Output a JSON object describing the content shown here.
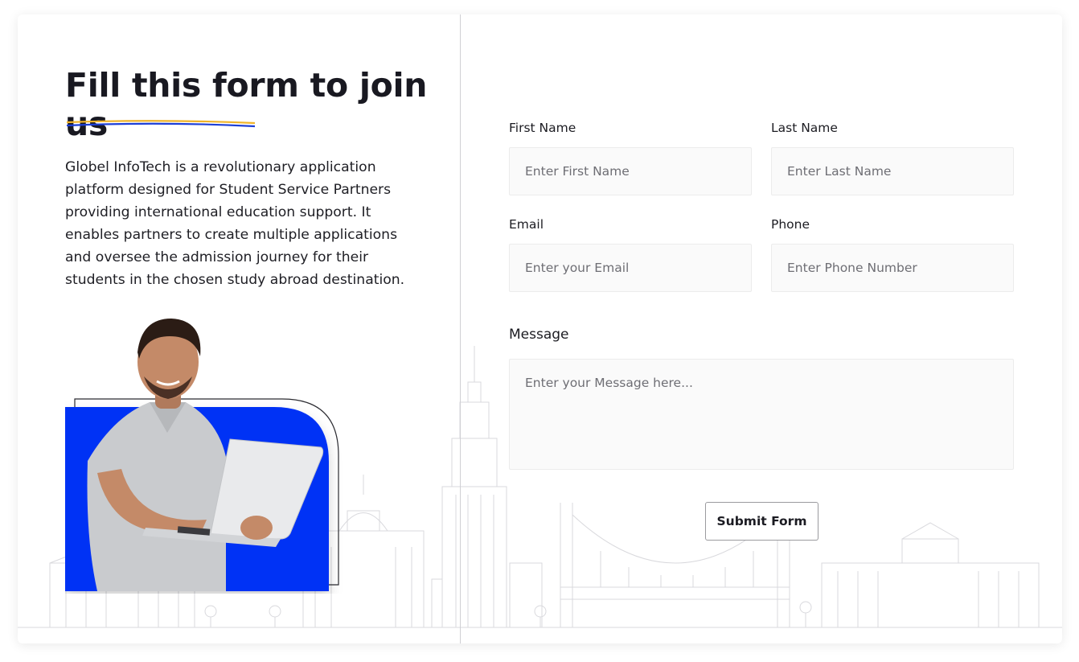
{
  "intro": {
    "title": "Fill this form to join us",
    "description": "Globel InfoTech is a revolutionary application platform designed for Student Service Partners providing international education support. It enables partners to create multiple applications and oversee the admission journey for their students in the chosen study abroad destination."
  },
  "form": {
    "first_name": {
      "label": "First Name",
      "placeholder": "Enter First Name"
    },
    "last_name": {
      "label": "Last Name",
      "placeholder": "Enter Last Name"
    },
    "email": {
      "label": "Email",
      "placeholder": "Enter your Email"
    },
    "phone": {
      "label": "Phone",
      "placeholder": "Enter Phone Number"
    },
    "message": {
      "label": "Message",
      "placeholder": "Enter your Message here..."
    },
    "submit_label": "Submit Form"
  },
  "colors": {
    "accent_blue": "#0033f5",
    "underline_yellow": "#f0b429",
    "underline_blue": "#1d3fd6"
  },
  "icons": {
    "hero_image": "man-holding-laptop-illustration",
    "background": "city-skyline-illustration"
  }
}
